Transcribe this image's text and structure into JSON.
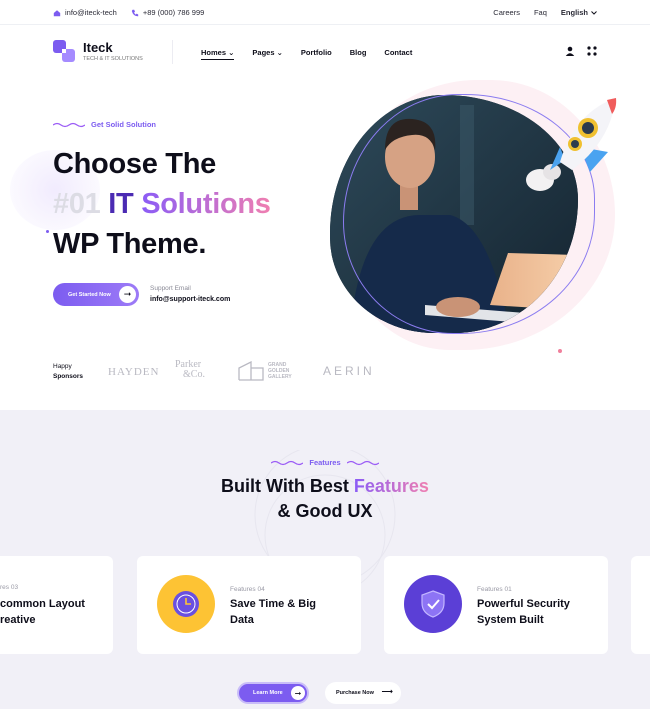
{
  "topbar": {
    "email": "info@iteck-tech",
    "phone": "+89 (000) 786 999",
    "links": [
      "Careers",
      "Faq"
    ],
    "language": "English"
  },
  "header": {
    "logo_name": "Iteck",
    "logo_tagline": "TECH & IT SOLUTIONS",
    "nav": [
      "Homes",
      "Pages",
      "Portfolio",
      "Blog",
      "Contact"
    ]
  },
  "hero": {
    "eyebrow": "Get Solid Solution",
    "line1": "Choose The",
    "line2_num": "#01",
    "line2_it": "IT",
    "line2_grad": "Solutions",
    "line3": "WP Theme.",
    "cta_label": "Get Started Now",
    "support_label": "Support Email",
    "support_email": "info@support-iteck.com",
    "sponsors_label_1": "Happy",
    "sponsors_label_2": "Sponsors",
    "sponsor_logos": [
      "HAYDEN",
      "Parker",
      "&Co.",
      "GRAND",
      "GOLDEN",
      "GALLERY",
      "AERIN"
    ]
  },
  "features": {
    "eyebrow": "Features",
    "title_1": "Built With Best",
    "title_1_grad": "Features",
    "title_2": "& Good UX",
    "cards": [
      {
        "num": "res 03",
        "title_1": "common Layout",
        "title_2": "reative"
      },
      {
        "num": "Features 04",
        "title_1": "Save Time & Big",
        "title_2": "Data"
      },
      {
        "num": "Features 01",
        "title_1": "Powerful Security",
        "title_2": "System Built"
      }
    ],
    "learn_label": "Learn More",
    "purchase_label": "Purchase Now"
  },
  "colors": {
    "accent": "#7c5cf0",
    "accent_pink": "#f07fb0",
    "section_bg": "#f1f0f7",
    "clock_yellow": "#fdc334"
  }
}
